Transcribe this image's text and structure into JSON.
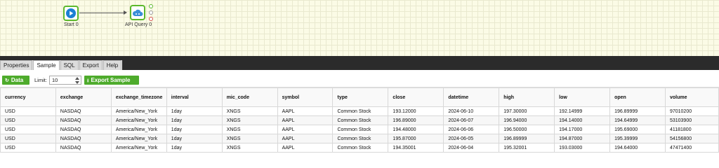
{
  "canvas": {
    "nodes": {
      "start": {
        "label": "Start 0"
      },
      "api_query": {
        "label": "API Query 0"
      }
    },
    "colors": {
      "node_border": "#5cb82c",
      "start_fill": "#1a7fd4",
      "cloud_fill": "#3a8ed8",
      "port_success": "#5cb82c",
      "port_neutral": "#9a9a9a",
      "port_error": "#d9534f"
    }
  },
  "tabs": [
    {
      "label": "Properties",
      "active": false
    },
    {
      "label": "Sample",
      "active": true
    },
    {
      "label": "SQL",
      "active": false
    },
    {
      "label": "Export",
      "active": false
    },
    {
      "label": "Help",
      "active": false
    }
  ],
  "toolbar": {
    "data_label": "Data",
    "limit_label": "Limit:",
    "limit_value": "10",
    "export_label": "Export Sample"
  },
  "table": {
    "columns": [
      "currency",
      "exchange",
      "exchange_timezone",
      "interval",
      "mic_code",
      "symbol",
      "type",
      "close",
      "datetime",
      "high",
      "low",
      "open",
      "volume"
    ],
    "rows": [
      [
        "USD",
        "NASDAQ",
        "America/New_York",
        "1day",
        "XNGS",
        "AAPL",
        "Common Stock",
        "193.12000",
        "2024-06-10",
        "197.30000",
        "192.14999",
        "196.89999",
        "97010200"
      ],
      [
        "USD",
        "NASDAQ",
        "America/New_York",
        "1day",
        "XNGS",
        "AAPL",
        "Common Stock",
        "196.89000",
        "2024-06-07",
        "196.94000",
        "194.14000",
        "194.64999",
        "53103900"
      ],
      [
        "USD",
        "NASDAQ",
        "America/New_York",
        "1day",
        "XNGS",
        "AAPL",
        "Common Stock",
        "194.48000",
        "2024-06-06",
        "196.50000",
        "194.17000",
        "195.69000",
        "41181800"
      ],
      [
        "USD",
        "NASDAQ",
        "America/New_York",
        "1day",
        "XNGS",
        "AAPL",
        "Common Stock",
        "195.87000",
        "2024-06-05",
        "196.89999",
        "194.87000",
        "195.39999",
        "54156800"
      ],
      [
        "USD",
        "NASDAQ",
        "America/New_York",
        "1day",
        "XNGS",
        "AAPL",
        "Common Stock",
        "194.35001",
        "2024-06-04",
        "195.32001",
        "193.03000",
        "194.64000",
        "47471400"
      ]
    ]
  }
}
